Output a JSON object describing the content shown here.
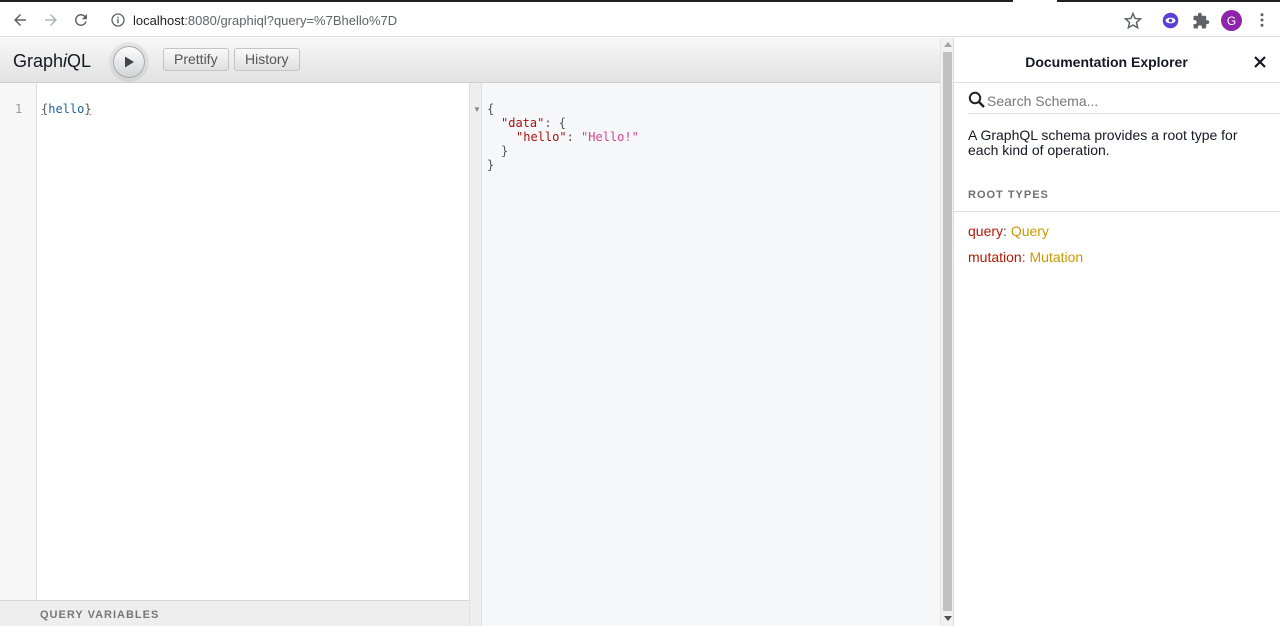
{
  "browser": {
    "url_host": "localhost",
    "url_rest": ":8080/graphiql?query=%7Bhello%7D",
    "profile_initial": "G"
  },
  "graphiql": {
    "title_prefix": "Graph",
    "title_italic": "i",
    "title_suffix": "QL",
    "prettify_label": "Prettify",
    "history_label": "History",
    "query_variables_label": "QUERY VARIABLES"
  },
  "editor": {
    "line_number": "1",
    "query_open": "{",
    "query_field": "hello",
    "query_close": "}"
  },
  "result": {
    "line1": "{",
    "data_key": "\"data\"",
    "data_sep": ": {",
    "hello_key": "\"hello\"",
    "hello_sep": ": ",
    "hello_value": "\"Hello!\"",
    "line4": "}",
    "line5": "}"
  },
  "docs": {
    "title": "Documentation Explorer",
    "search_placeholder": "Search Schema...",
    "description": "A GraphQL schema provides a root type for each kind of operation.",
    "root_types_label": "ROOT TYPES",
    "root_types": [
      {
        "name": "query",
        "type": "Query"
      },
      {
        "name": "mutation",
        "type": "Mutation"
      }
    ]
  },
  "colors": {
    "field_name": "#b11a04",
    "type_name": "#ca9800",
    "json_key": "#aa1111",
    "json_string": "#d64292",
    "profile_avatar": "#8e24aa"
  }
}
